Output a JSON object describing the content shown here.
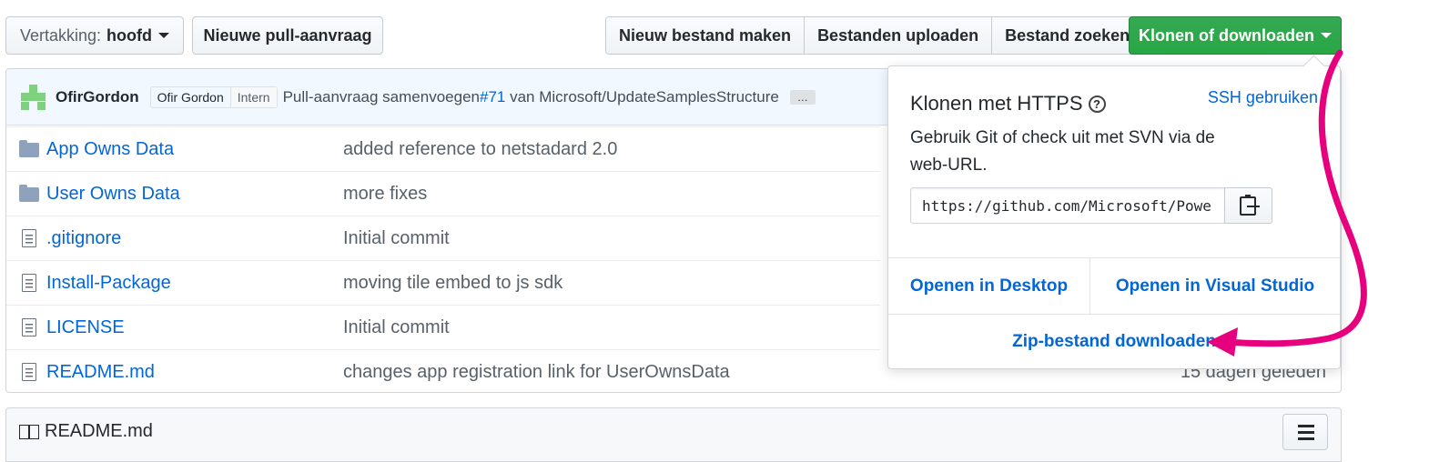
{
  "toolbar": {
    "branch_label": "Vertakking:",
    "branch_value": "hoofd",
    "new_pr": "Nieuwe pull-aanvraag",
    "create_file": "Nieuw bestand maken",
    "upload_files": "Bestanden uploaden",
    "find_file": "Bestand zoeken",
    "clone_download": "Klonen of downloaden"
  },
  "commit": {
    "author": "OfirGordon",
    "badge_name": "Ofir Gordon",
    "badge_role": "Intern",
    "message_prefix": "Pull-aanvraag samenvoegen",
    "pr_link": "#71",
    "message_suffix": " van Microsoft/UpdateSamplesStructure",
    "ellipsis": "…"
  },
  "files": [
    {
      "type": "folder",
      "name": "App Owns Data",
      "message": "added reference to netstadard 2.0"
    },
    {
      "type": "folder",
      "name": "User Owns Data",
      "message": "more fixes"
    },
    {
      "type": "file",
      "name": ".gitignore",
      "message": "Initial commit"
    },
    {
      "type": "file",
      "name": "Install-Package",
      "message": "moving tile embed to js sdk"
    },
    {
      "type": "file",
      "name": "LICENSE",
      "message": "Initial commit"
    },
    {
      "type": "file",
      "name": "README.md",
      "message": "changes app registration link for UserOwnsData"
    }
  ],
  "last_age": "15 dagen geleden",
  "readme": {
    "title": "README.md"
  },
  "clone_panel": {
    "title": "Klonen met HTTPS",
    "help_glyph": "?",
    "ssh_link": "SSH gebruiken",
    "description": "Gebruik Git of check uit met SVN via de web-URL.",
    "url_value": "https://github.com/Microsoft/PowerBI-Developer-Samples.git",
    "open_desktop": "Openen in Desktop",
    "open_visual_studio": "Openen in Visual Studio",
    "download_zip": "Zip-bestand downloaden"
  },
  "colors": {
    "primary_green": "#28a745",
    "link_blue": "#0366d6",
    "annotation_pink": "#e6007e"
  }
}
